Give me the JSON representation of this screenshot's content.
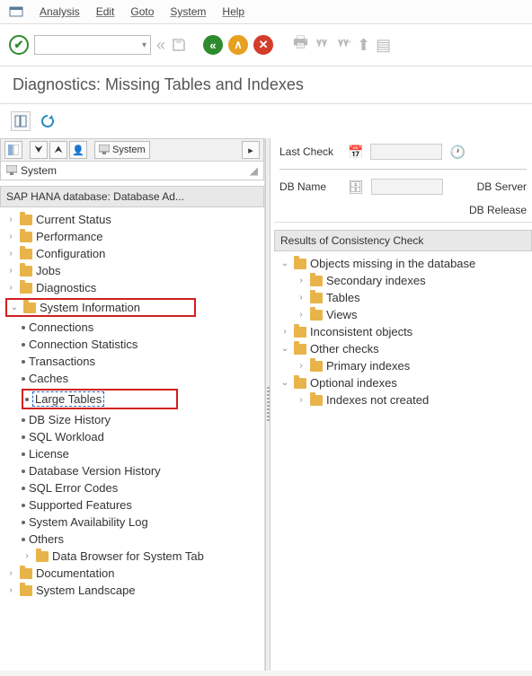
{
  "menu": {
    "items": [
      "Analysis",
      "Edit",
      "Goto",
      "System",
      "Help"
    ]
  },
  "title": "Diagnostics: Missing Tables and Indexes",
  "toolbar": {
    "system_button_label": "System"
  },
  "left_panel": {
    "system_label": "System",
    "section_header": "SAP HANA database: Database Ad...",
    "tree": {
      "current_status": "Current Status",
      "performance": "Performance",
      "configuration": "Configuration",
      "jobs": "Jobs",
      "diagnostics": "Diagnostics",
      "system_information": "System Information",
      "sys_info_children": {
        "connections": "Connections",
        "connection_statistics": "Connection Statistics",
        "transactions": "Transactions",
        "caches": "Caches",
        "large_tables": "Large Tables",
        "db_size_history": "DB Size History",
        "sql_workload": "SQL Workload",
        "license": "License",
        "db_version_history": "Database Version History",
        "sql_error_codes": "SQL Error Codes",
        "supported_features": "Supported Features",
        "system_availability_log": "System Availability Log",
        "others": "Others",
        "data_browser": "Data Browser for System Tab"
      },
      "documentation": "Documentation",
      "system_landscape": "System Landscape"
    }
  },
  "right_panel": {
    "last_check_label": "Last Check",
    "db_name_label": "DB Name",
    "db_server_label": "DB Server",
    "db_release_label": "DB Release",
    "results_header": "Results of Consistency Check",
    "tree": {
      "objects_missing": "Objects missing in the database",
      "secondary_indexes": "Secondary indexes",
      "tables": "Tables",
      "views": "Views",
      "inconsistent_objects": "Inconsistent objects",
      "other_checks": "Other checks",
      "primary_indexes": "Primary indexes",
      "optional_indexes": "Optional indexes",
      "indexes_not_created": "Indexes not created"
    }
  }
}
